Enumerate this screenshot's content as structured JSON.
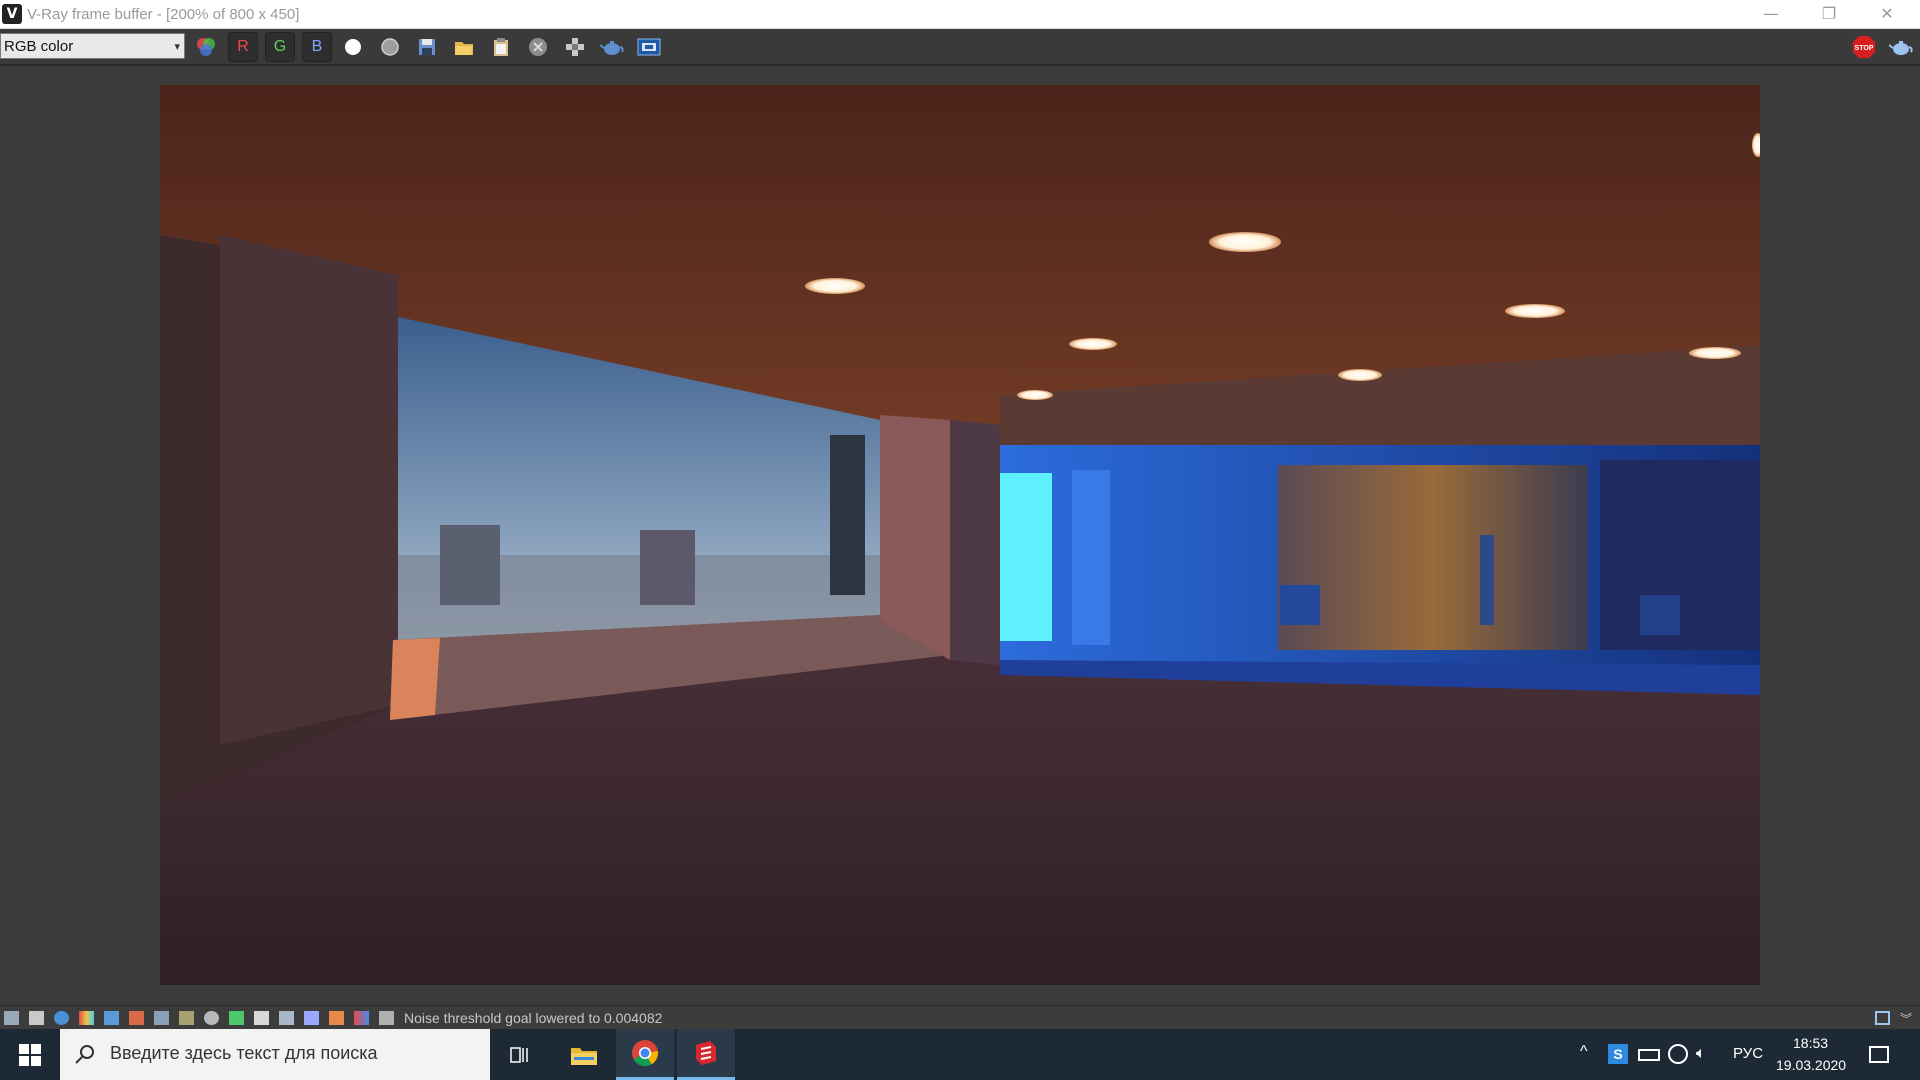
{
  "window": {
    "title": "V-Ray frame buffer - [200% of 800 x 450]",
    "logo_letter": "V",
    "controls": {
      "minimize": "—",
      "maximize": "❐",
      "close": "✕"
    }
  },
  "toolbar": {
    "channel_select": {
      "value": "RGB color",
      "arrow": "▾"
    },
    "channel_r": "R",
    "channel_g": "G",
    "channel_b": "B",
    "icons": [
      "color-channels-icon",
      "white-circle-icon",
      "grey-circle-icon",
      "save-icon",
      "open-folder-icon",
      "clipboard-icon",
      "clear-icon",
      "track-mouse-icon",
      "teapot-render-icon",
      "vfb-history-icon",
      "stop-render-icon",
      "render-teapot-icon"
    ],
    "stop_label": "STOP",
    "accent_red": "#d81e1e",
    "accent_blue": "#2e6fb8"
  },
  "status": {
    "message": "Noise threshold goal lowered to 0.004082",
    "icons": [
      "panel-icon",
      "list-icon",
      "info-icon",
      "color-gradient-icon",
      "lut-icon",
      "stats-icon",
      "histogram-icon",
      "correction-icon",
      "lens-icon",
      "hue-icon",
      "curve-icon",
      "lut-file-icon",
      "ocio-icon",
      "exposure-icon",
      "levels-icon",
      "crop-icon"
    ]
  },
  "taskbar": {
    "search_placeholder": "Введите здесь текст для поиска",
    "apps": [
      "task-view-icon",
      "file-explorer-icon",
      "chrome-icon",
      "sketchup-icon"
    ],
    "tray": {
      "chevron": "^",
      "lang": "РУС",
      "time": "18:53",
      "date": "19.03.2020"
    }
  }
}
